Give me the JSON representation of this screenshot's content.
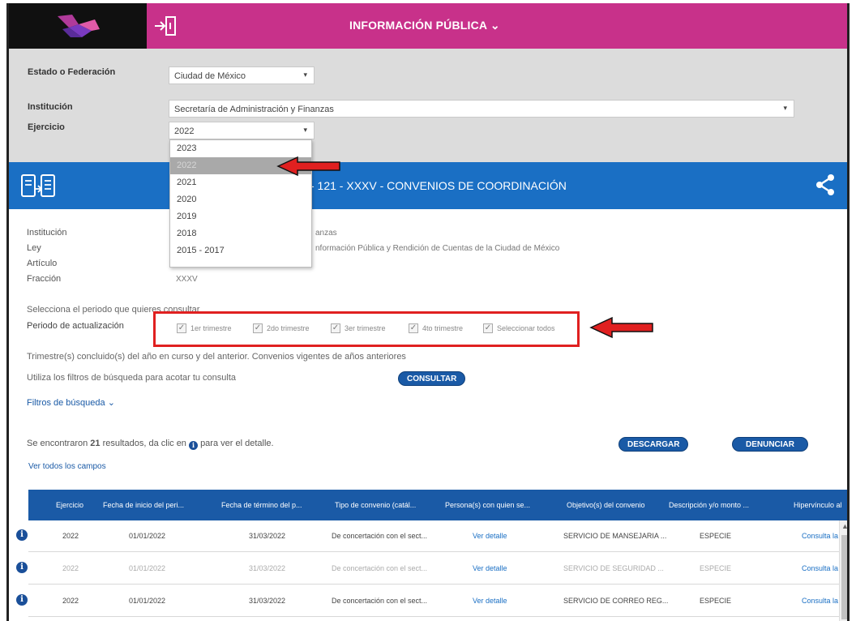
{
  "header": {
    "title": "INFORMACIÓN PÚBLICA",
    "title_caret": "⌄"
  },
  "filters": {
    "estado_label": "Estado o Federación",
    "estado_value": "Ciudad de México",
    "institucion_label": "Institución",
    "institucion_value": "Secretaría de Administración y Finanzas",
    "ejercicio_label": "Ejercicio",
    "ejercicio_value": "2022",
    "caret": "▾"
  },
  "ejercicio_dropdown": {
    "options": [
      "2023",
      "2022",
      "2021",
      "2020",
      "2019",
      "2018",
      "2015 - 2017"
    ],
    "selected": "2022"
  },
  "banner": {
    "title": "- 121 - XXXV - CONVENIOS DE COORDINACIÓN"
  },
  "info": {
    "institucion_label": "Institución",
    "institucion_value_partial": "anzas",
    "ley_label": "Ley",
    "ley_value_partial": "nformación Pública y Rendición de Cuentas de la Ciudad de México",
    "articulo_label": "Artículo",
    "fraccion_label": "Fracción",
    "fraccion_value": "XXXV"
  },
  "periodo": {
    "prompt": "Selecciona el periodo que quieres consultar",
    "label": "Periodo de actualización",
    "options": [
      "1er trimestre",
      "2do trimestre",
      "3er trimestre",
      "4to trimestre",
      "Seleccionar todos"
    ]
  },
  "notes": {
    "trimestre_note": "Trimestre(s) concluido(s) del año en curso y del anterior. Convenios vigentes de años anteriores",
    "filtros_hint": "Utiliza los filtros de búsqueda para acotar tu consulta",
    "consultar_button": "CONSULTAR",
    "filtros_link": "Filtros de búsqueda",
    "filtros_caret": "⌄"
  },
  "results": {
    "prefix": "Se encontraron",
    "count": "21",
    "suffix_a": "resultados, da clic en",
    "suffix_b": "para ver el detalle.",
    "descargar_button": "DESCARGAR",
    "denunciar_button": "DENUNCIAR",
    "ver_todos_link": "Ver todos los campos"
  },
  "table": {
    "headers": [
      "Ejercicio",
      "Fecha de inicio del peri...",
      "Fecha de término del p...",
      "Tipo de convenio (catál...",
      "Persona(s) con quien se...",
      "Objetivo(s) del convenio",
      "Descripción y/o monto ...",
      "Hipervínculo al"
    ],
    "rows": [
      [
        "2022",
        "01/01/2022",
        "31/03/2022",
        "De concertación con el sect...",
        "Ver detalle",
        "SERVICIO DE MANSEJARIA ...",
        "ESPECIE",
        "Consulta la"
      ],
      [
        "2022",
        "01/01/2022",
        "31/03/2022",
        "De concertación con el sect...",
        "Ver detalle",
        "SERVICIO DE SEGURIDAD ...",
        "ESPECIE",
        "Consulta la"
      ],
      [
        "2022",
        "01/01/2022",
        "31/03/2022",
        "De concertación con el sect...",
        "Ver detalle",
        "SERVICIO DE CORREO REG...",
        "ESPECIE",
        "Consulta la"
      ]
    ],
    "info_glyph": "i",
    "scroll_up": "▲"
  },
  "colors": {
    "header_magenta": "#c8318a",
    "banner_blue": "#1a6fc4",
    "button_blue": "#1a5aa6",
    "highlight_red": "#e02020"
  },
  "icons": [
    "logo-icon",
    "login-icon",
    "transparency-icon",
    "share-icon",
    "red-arrow-icon",
    "info-icon"
  ]
}
